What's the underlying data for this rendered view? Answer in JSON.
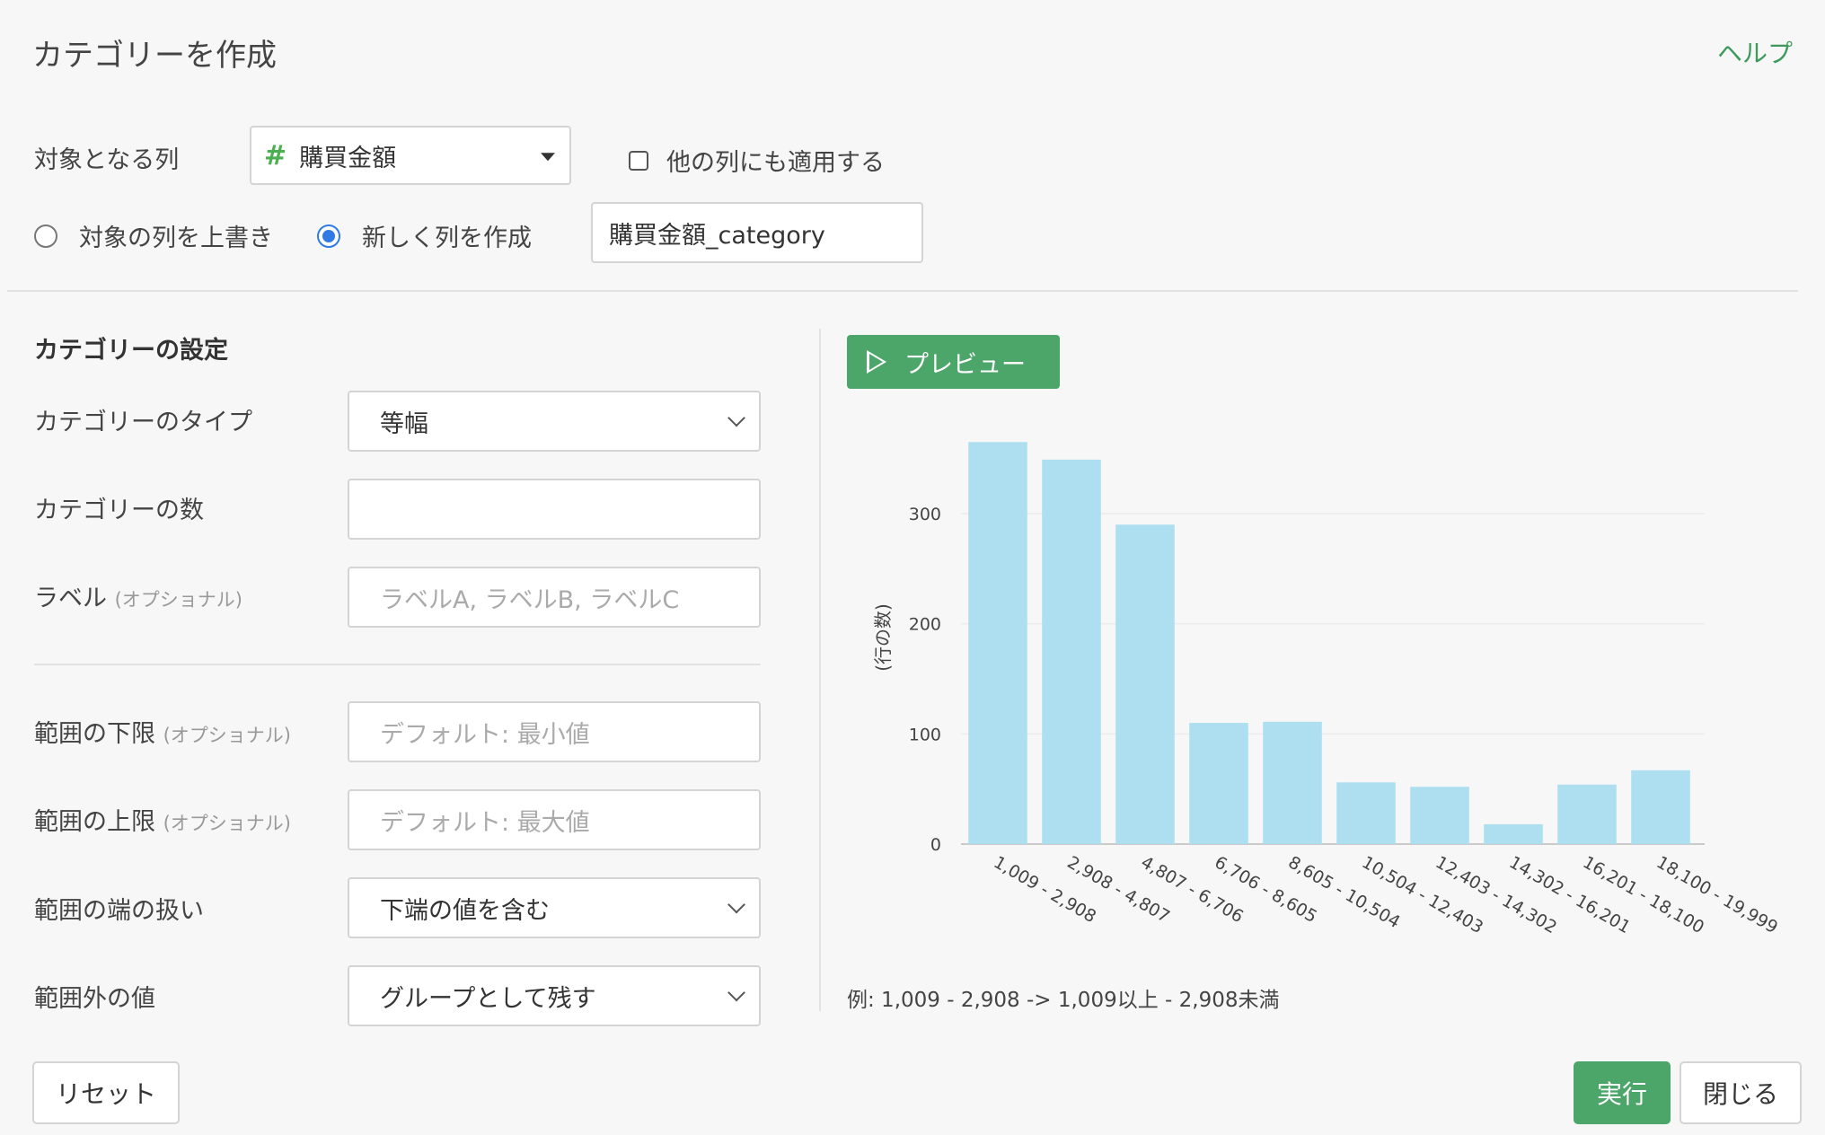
{
  "header": {
    "title": "カテゴリーを作成",
    "help": "ヘルプ"
  },
  "target": {
    "label": "対象となる列",
    "column": "購買金額",
    "column_icon": "hash-icon",
    "apply_other": "他の列にも適用する",
    "overwrite": "対象の列を上書き",
    "create_new": "新しく列を作成",
    "new_column_name": "購買金額_category"
  },
  "settings": {
    "heading": "カテゴリーの設定",
    "type_label": "カテゴリーのタイプ",
    "type_value": "等幅",
    "count_label": "カテゴリーの数",
    "count_value": "",
    "label_label": "ラベル",
    "optional": "(オプショナル)",
    "label_placeholder": "ラベルA, ラベルB, ラベルC",
    "lower_label": "範囲の下限",
    "lower_placeholder": "デフォルト: 最小値",
    "upper_label": "範囲の上限",
    "upper_placeholder": "デフォルト: 最大値",
    "edge_label": "範囲の端の扱い",
    "edge_value": "下端の値を含む",
    "outside_label": "範囲外の値",
    "outside_value": "グループとして残す"
  },
  "preview": {
    "button": "プレビュー",
    "note": "例: 1,009 - 2,908 -> 1,009以上 - 2,908未満"
  },
  "footer": {
    "reset": "リセット",
    "run": "実行",
    "close": "閉じる"
  },
  "colors": {
    "accent": "#4ca66a",
    "bar": "#addff1",
    "help": "#3d9a5c",
    "radio": "#2f7ae5"
  },
  "chart_data": {
    "type": "bar",
    "categories": [
      "1,009 - 2,908",
      "2,908 - 4,807",
      "4,807 - 6,706",
      "6,706 - 8,605",
      "8,605 - 10,504",
      "10,504 - 12,403",
      "12,403 - 14,302",
      "14,302 - 16,201",
      "16,201 - 18,100",
      "18,100 - 19,999"
    ],
    "values": [
      365,
      349,
      290,
      110,
      111,
      56,
      52,
      18,
      54,
      67
    ],
    "ylabel": "(行の数)",
    "yticks": [
      0,
      100,
      200,
      300
    ],
    "ylim": [
      0,
      375
    ],
    "grid": true
  }
}
